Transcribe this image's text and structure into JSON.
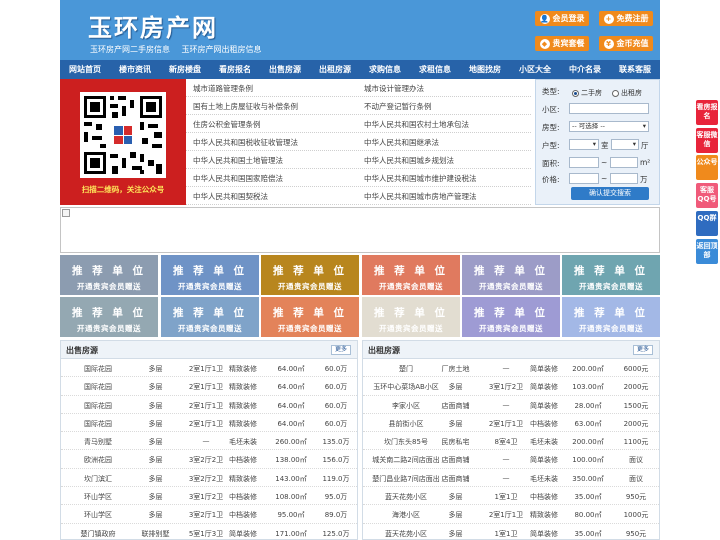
{
  "header": {
    "title": "玉环房产网",
    "subtitle_links": [
      "玉环房产网二手房信息",
      "玉环房产网出租房信息"
    ],
    "buttons": [
      "会员登录",
      "免费注册",
      "贵宾套餐",
      "金币充值"
    ],
    "button_icons": [
      "user-icon",
      "user-plus-icon",
      "package-icon",
      "coin-icon"
    ]
  },
  "nav": {
    "items": [
      "网站首页",
      "楼市资讯",
      "新房楼盘",
      "看房报名",
      "出售房源",
      "出租房源",
      "求购信息",
      "求租信息",
      "地图找房",
      "小区大全",
      "中介名录",
      "联系客服"
    ]
  },
  "qr": {
    "caption": "扫描二维码，关注公众号"
  },
  "links": {
    "rows": [
      [
        "城市道路管理条例",
        "城市设计管理办法"
      ],
      [
        "国有土地上房屋征收与补偿条例",
        "不动产登记暂行条例"
      ],
      [
        "住房公积金管理条例",
        "中华人民共和国农村土地承包法"
      ],
      [
        "中华人民共和国税收征收管理法",
        "中华人民共和国继承法"
      ],
      [
        "中华人民共和国土地管理法",
        "中华人民共和国城乡规划法"
      ],
      [
        "中华人民共和国国家赔偿法",
        "中华人民共和国城市维护建设税法"
      ],
      [
        "中华人民共和国契税法",
        "中华人民共和国城市房地产管理法"
      ]
    ]
  },
  "search": {
    "type_label": "类型:",
    "type_options": [
      "二手房",
      "出租房"
    ],
    "type_selected": "二手房",
    "community_label": "小区:",
    "community_value": "",
    "room_label": "房型:",
    "room_select": "-- 可选择 --",
    "unit_label": "户型:",
    "unit_room": "室",
    "unit_hall": "厅",
    "area_label": "面积:",
    "area_unit": "m²",
    "price_label": "价格:",
    "price_unit": "万",
    "range_sep": "~",
    "submit": "确认提交搜索"
  },
  "ads": {
    "line1": "推 荐 单 位",
    "line2": "开通贵宾会员赠送",
    "colors": [
      "#8c9cb0",
      "#6f93c6",
      "#b8861e",
      "#a35f55",
      "#e07a5f",
      "#9c9cc7",
      "#6fa5b0",
      "#94a8b2",
      "#7fa3c9",
      "#e3835a",
      "#a8a39a",
      "#e2ddd1",
      "#9e9bd4",
      "#a3b8e6"
    ]
  },
  "sale": {
    "title": "出售房源",
    "more": "更多",
    "rows": [
      [
        "国际花园",
        "多层",
        "2室1厅1卫",
        "精致装修",
        "64.00㎡",
        "60.0万"
      ],
      [
        "国际花园",
        "多层",
        "2室1厅1卫",
        "精致装修",
        "64.00㎡",
        "60.0万"
      ],
      [
        "国际花园",
        "多层",
        "2室1厅1卫",
        "精致装修",
        "64.00㎡",
        "60.0万"
      ],
      [
        "国际花园",
        "多层",
        "2室1厅1卫",
        "精致装修",
        "64.00㎡",
        "60.0万"
      ],
      [
        "青马别墅",
        "多层",
        "—",
        "毛坯未装",
        "260.00㎡",
        "135.0万"
      ],
      [
        "欧洲花园",
        "多层",
        "3室2厅2卫",
        "中档装修",
        "138.00㎡",
        "156.0万"
      ],
      [
        "坎门滨汇",
        "多层",
        "3室2厅2卫",
        "精致装修",
        "143.00㎡",
        "119.0万"
      ],
      [
        "环山学区",
        "多层",
        "3室1厅2卫",
        "中档装修",
        "108.00㎡",
        "95.0万"
      ],
      [
        "环山学区",
        "多层",
        "3室2厅1卫",
        "中档装修",
        "95.00㎡",
        "89.0万"
      ],
      [
        "楚门镇政府",
        "联排别墅",
        "5室1厅3卫",
        "简单装修",
        "171.00㎡",
        "125.0万"
      ]
    ]
  },
  "rent": {
    "title": "出租房源",
    "more": "更多",
    "rows": [
      [
        "楚门",
        "厂房土地",
        "—",
        "简单装修",
        "200.00㎡",
        "6000元"
      ],
      [
        "玉环中心菜场AB小区",
        "多层",
        "3室1厅2卫",
        "简单装修",
        "103.00㎡",
        "2000元"
      ],
      [
        "李家小区",
        "店面商铺",
        "—",
        "简单装修",
        "28.00㎡",
        "1500元"
      ],
      [
        "县前街小区",
        "多层",
        "2室1厅1卫",
        "中档装修",
        "63.00㎡",
        "2000元"
      ],
      [
        "坎门东头85号",
        "民房私宅",
        "8室4卫",
        "毛坯未装",
        "200.00㎡",
        "1100元"
      ],
      [
        "城关南二路2间店面出",
        "店面商铺",
        "—",
        "简单装修",
        "100.00㎡",
        "面议"
      ],
      [
        "楚门昌业路7间店面出",
        "店面商铺",
        "—",
        "毛坯未装",
        "350.00㎡",
        "面议"
      ],
      [
        "蓝天花苑小区",
        "多层",
        "1室1卫",
        "中档装修",
        "35.00㎡",
        "950元"
      ],
      [
        "海港小区",
        "多层",
        "2室1厅1卫",
        "精致装修",
        "80.00㎡",
        "1000元"
      ],
      [
        "蓝天花苑小区",
        "多层",
        "1室1卫",
        "简单装修",
        "35.00㎡",
        "950元"
      ]
    ]
  },
  "side": {
    "items": [
      "看房报名",
      "客服微信",
      "公众号",
      "客服QQ号",
      "QQ群",
      "返回顶部"
    ],
    "colors": [
      "#e8243a",
      "#e8243a",
      "#f08a1c",
      "#f05a7a",
      "#2f6cc0",
      "#3a8bd8"
    ]
  }
}
